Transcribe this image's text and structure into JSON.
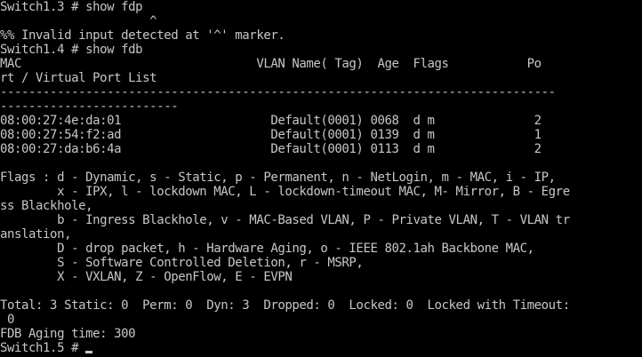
{
  "window": {
    "title": "",
    "colors": {
      "background": "#000000",
      "foreground": "#c7c7c7"
    }
  },
  "terminal": {
    "lines": [
      "Switch1.3 # show fdp",
      "                     ^",
      "%% Invalid input detected at '^' marker.",
      "Switch1.4 # show fdb",
      "MAC                                 VLAN Name( Tag)  Age  Flags           Po",
      "rt / Virtual Port List",
      "------------------------------------------------------------------------------",
      "-------------------------",
      "08:00:27:4e:da:01                     Default(0001) 0068  d m              2",
      "08:00:27:54:f2:ad                     Default(0001) 0139  d m              1",
      "08:00:27:da:b6:4a                     Default(0001) 0113  d m              2",
      "",
      "Flags : d - Dynamic, s - Static, p - Permanent, n - NetLogin, m - MAC, i - IP,",
      "        x - IPX, l - lockdown MAC, L - lockdown-timeout MAC, M- Mirror, B - Egre",
      "ss Blackhole,",
      "        b - Ingress Blackhole, v - MAC-Based VLAN, P - Private VLAN, T - VLAN tr",
      "anslation,",
      "        D - drop packet, h - Hardware Aging, o - IEEE 802.1ah Backbone MAC,",
      "        S - Software Controlled Deletion, r - MSRP,",
      "        X - VXLAN, Z - OpenFlow, E - EVPN",
      "",
      "Total: 3 Static: 0  Perm: 0  Dyn: 3  Dropped: 0  Locked: 0  Locked with Timeout:",
      " 0",
      "FDB Aging time: 300",
      "Switch1.5 # "
    ]
  }
}
